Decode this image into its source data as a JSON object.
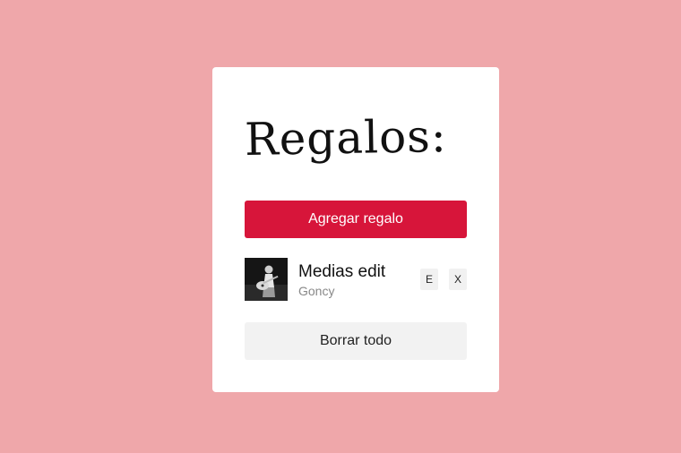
{
  "page": {
    "background_color": "#efa7aa"
  },
  "card": {
    "title": "Regalos:",
    "add_button_label": "Agregar regalo",
    "add_button_color": "#d7153a",
    "gifts": [
      {
        "name": "Medias edit",
        "recipient": "Goncy",
        "image_icon": "guitarist-photo",
        "edit_label": "E",
        "delete_label": "X"
      }
    ],
    "clear_button_label": "Borrar todo"
  }
}
